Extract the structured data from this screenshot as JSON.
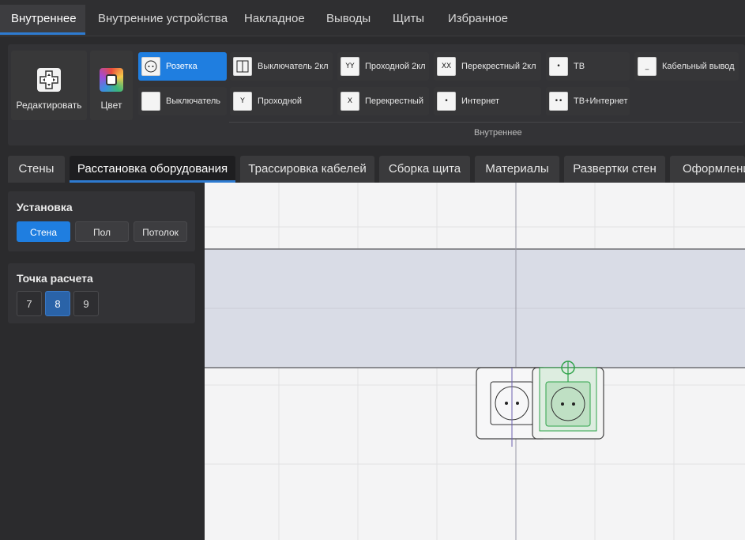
{
  "top_tabs": [
    {
      "label": "Внутреннее"
    },
    {
      "label": "Внутренние устройства"
    },
    {
      "label": "Накладное"
    },
    {
      "label": "Выводы"
    },
    {
      "label": "Щиты"
    },
    {
      "label": "Избранное"
    }
  ],
  "ribbon": {
    "edit_label": "Редактировать",
    "color_label": "Цвет",
    "group_label": "Внутреннее",
    "items": [
      {
        "label": "Розетка",
        "icon": "socket-icon",
        "glyph": "∘∘"
      },
      {
        "label": "Выключатель",
        "icon": "switch-icon",
        "glyph": ""
      },
      {
        "label": "Выключатель 2кл",
        "icon": "switch-2-icon",
        "glyph": "||"
      },
      {
        "label": "Проходной",
        "icon": "pass-switch-icon",
        "glyph": "Y"
      },
      {
        "label": "Проходной 2кл",
        "icon": "pass-switch-2-icon",
        "glyph": "YY"
      },
      {
        "label": "Перекрестный",
        "icon": "cross-switch-icon",
        "glyph": "X"
      },
      {
        "label": "Перекрестный 2кл",
        "icon": "cross-switch-2-icon",
        "glyph": "XX"
      },
      {
        "label": "Интернет",
        "icon": "internet-icon",
        "glyph": "•"
      },
      {
        "label": "ТВ",
        "icon": "tv-icon",
        "glyph": "•"
      },
      {
        "label": "ТВ+Интернет",
        "icon": "tv-internet-icon",
        "glyph": "••"
      },
      {
        "label": "Кабельный вывод",
        "icon": "cable-outlet-icon",
        "glyph": "_"
      }
    ]
  },
  "mode_tabs": [
    {
      "label": "Стены"
    },
    {
      "label": "Расстановка оборудования"
    },
    {
      "label": "Трассировка кабелей"
    },
    {
      "label": "Сборка щита"
    },
    {
      "label": "Материалы"
    },
    {
      "label": "Развертки стен"
    },
    {
      "label": "Оформлени"
    }
  ],
  "installation": {
    "title": "Установка",
    "options": [
      {
        "label": "Стена"
      },
      {
        "label": "Пол"
      },
      {
        "label": "Потолок"
      }
    ],
    "selected": "Стена"
  },
  "calc_point": {
    "title": "Точка расчета",
    "options": [
      {
        "label": "7"
      },
      {
        "label": "8"
      },
      {
        "label": "9"
      }
    ],
    "selected": "8"
  },
  "colors": {
    "accent": "#1f7ee0",
    "selection_green": "#2fa34a",
    "wall_fill": "#d9dce6"
  }
}
